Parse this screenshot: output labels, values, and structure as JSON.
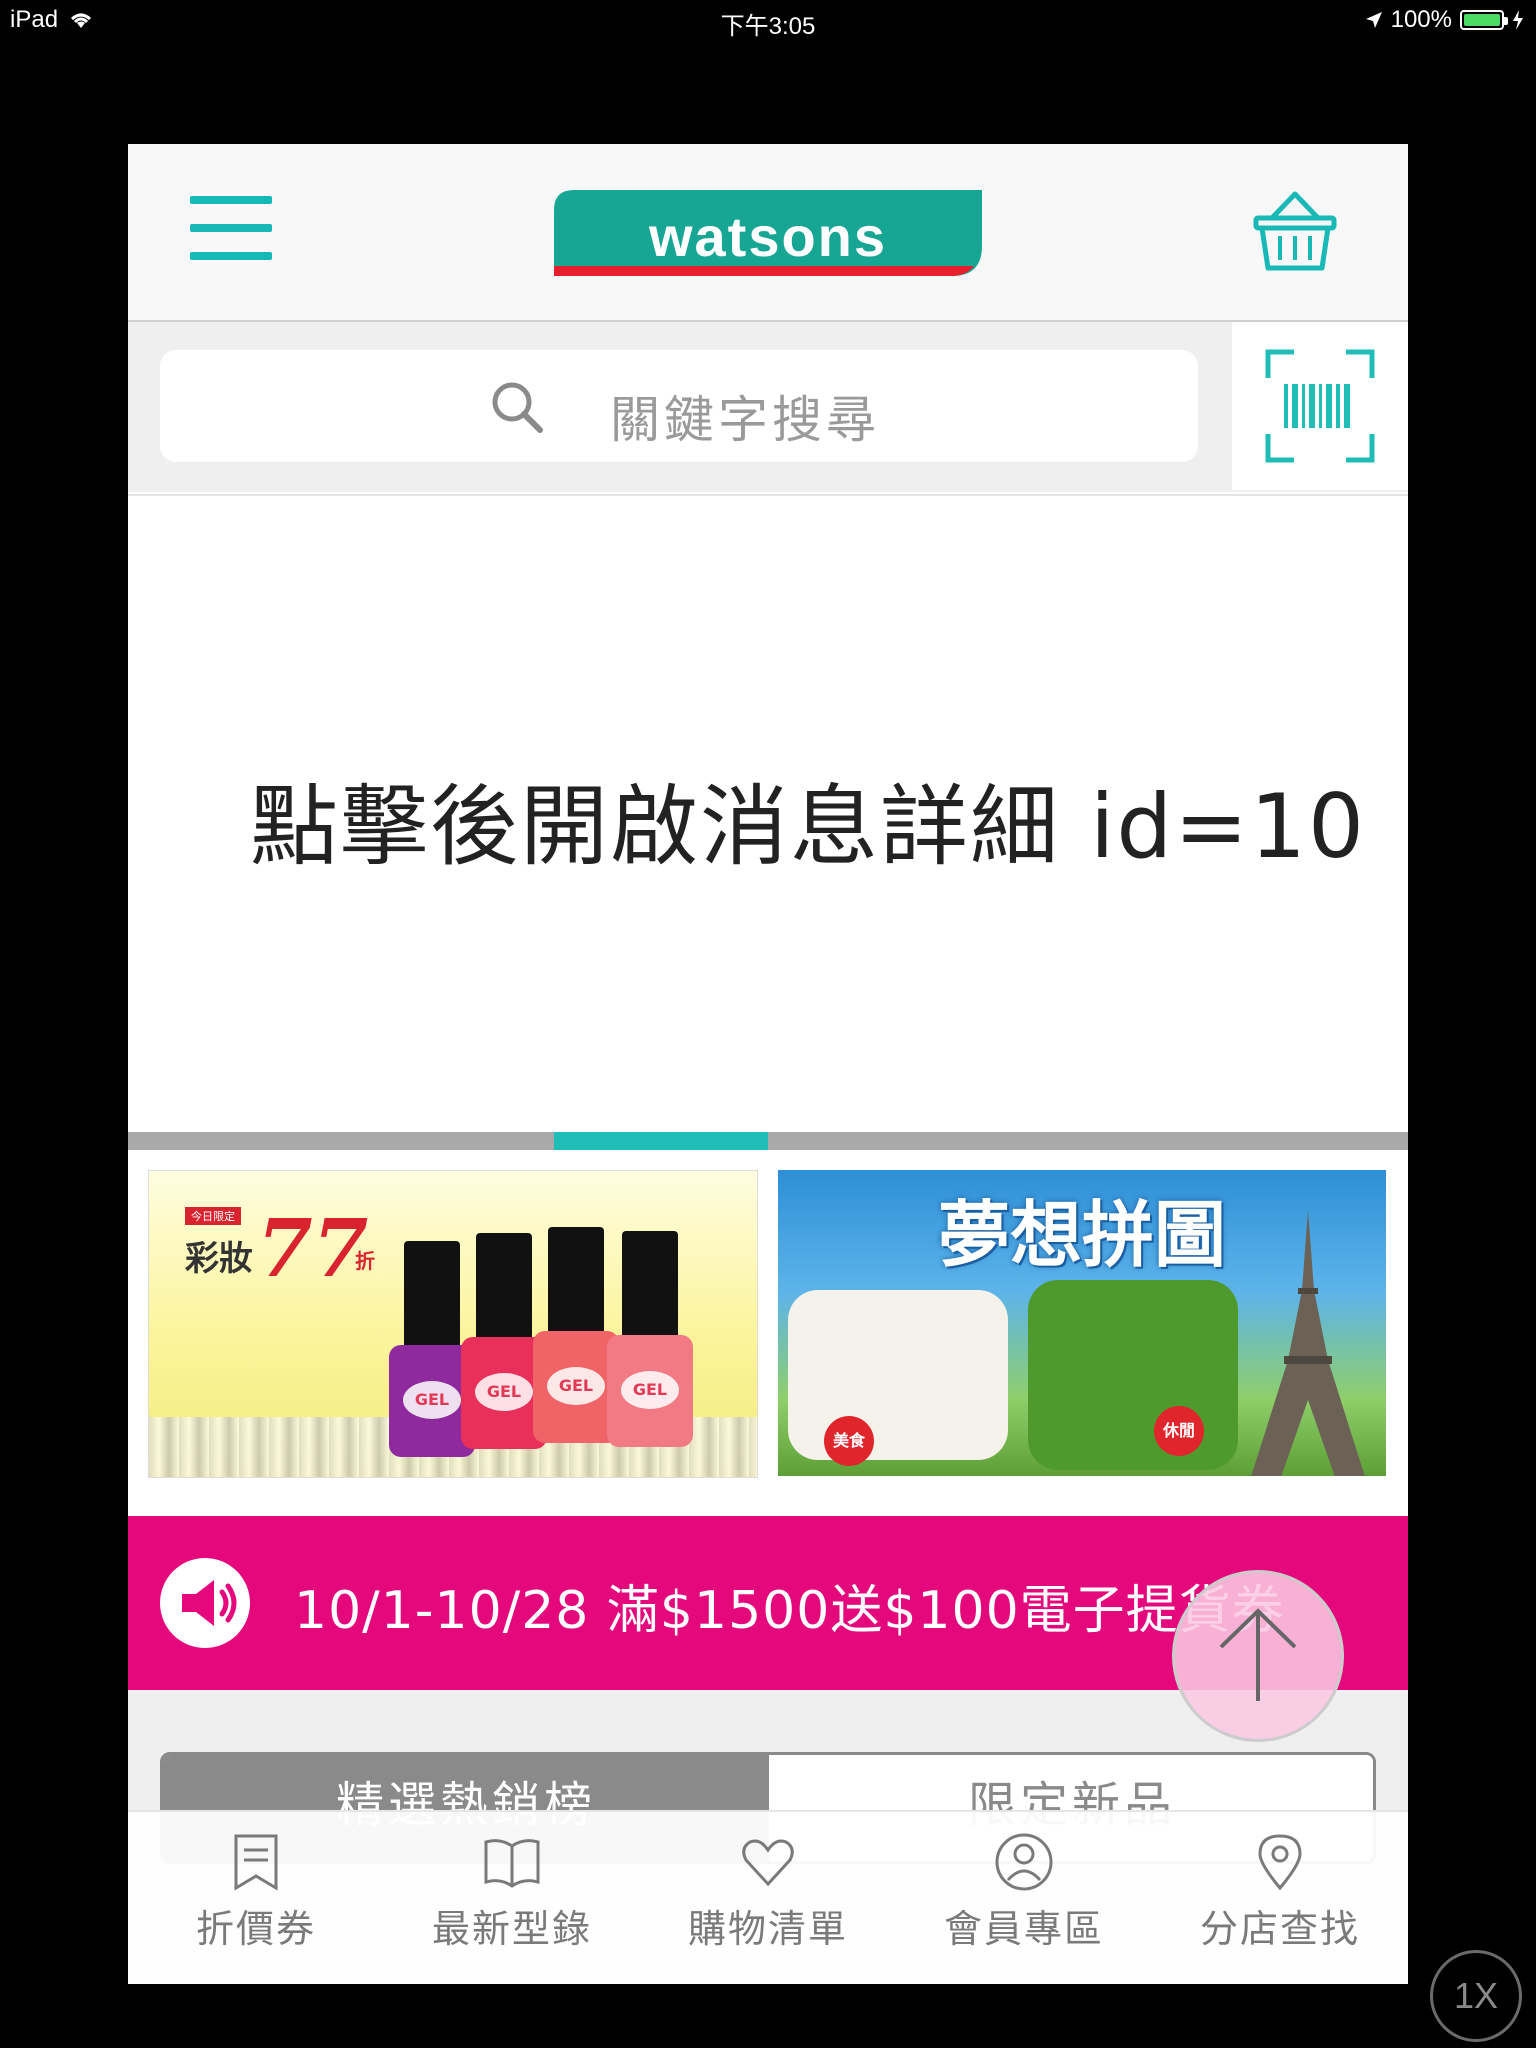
{
  "status_bar": {
    "device": "iPad",
    "time": "下午3:05",
    "battery": "100%"
  },
  "header": {
    "logo_text": "watsons",
    "menu_icon": "hamburger-menu-icon",
    "cart_icon": "basket-icon"
  },
  "search": {
    "placeholder": "關鍵字搜尋",
    "barcode_icon": "barcode-scan-icon"
  },
  "banner": {
    "message": "點擊後開啟消息詳細 id=10",
    "pager": {
      "count": 6,
      "active_index": 2
    }
  },
  "promos": [
    {
      "name": "makeup-promo",
      "tag": "今日限定",
      "title": "彩妝",
      "number": "77",
      "suffix": "折",
      "product_label": "GEL"
    },
    {
      "name": "dream-puzzle-promo",
      "title": "夢想拼圖",
      "tags": [
        "美食",
        "休閒"
      ]
    }
  ],
  "announcement": {
    "icon": "megaphone-icon",
    "text": "10/1-10/28 滿$1500送$100電子提貨券"
  },
  "tabs": [
    {
      "label": "精選熱銷榜",
      "active": true
    },
    {
      "label": "限定新品",
      "active": false
    }
  ],
  "scroll_top_icon": "arrow-up-icon",
  "bottom_nav": [
    {
      "label": "折價券",
      "icon": "bookmark-icon"
    },
    {
      "label": "最新型錄",
      "icon": "book-icon"
    },
    {
      "label": "購物清單",
      "icon": "heart-icon"
    },
    {
      "label": "會員專區",
      "icon": "user-icon"
    },
    {
      "label": "分店查找",
      "icon": "location-pin-icon"
    }
  ],
  "zoom_button": "1X",
  "colors": {
    "brand_teal": "#17b8b5",
    "announce_magenta": "#e5077c",
    "pager_active": "#1fbcb8"
  }
}
